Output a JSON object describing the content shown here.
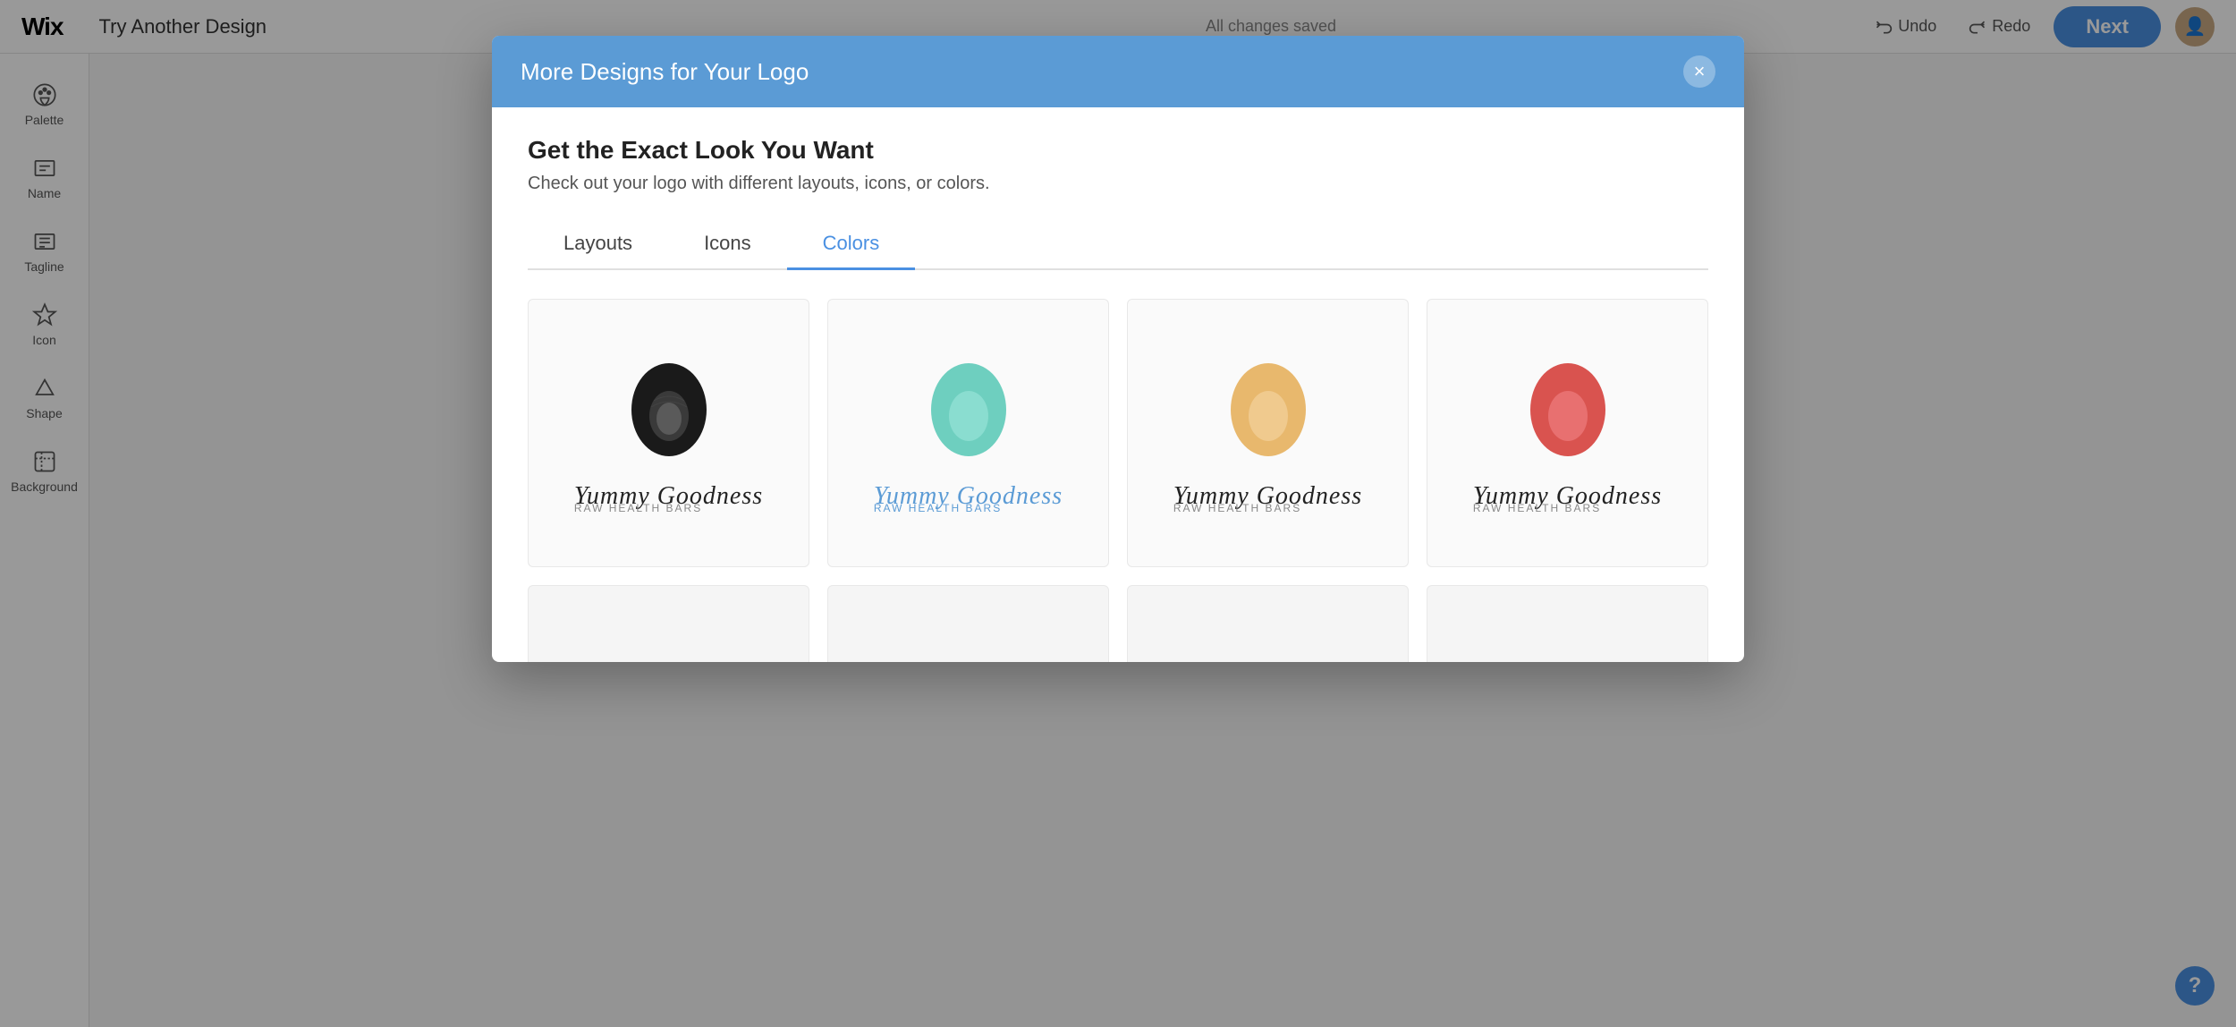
{
  "app": {
    "logo": "Wix",
    "title": "Try Another Design",
    "status": "All changes saved",
    "undo_label": "Undo",
    "redo_label": "Redo",
    "next_label": "Next"
  },
  "sidebar": {
    "items": [
      {
        "id": "palette",
        "label": "Palette",
        "icon": "palette-icon"
      },
      {
        "id": "name",
        "label": "Name",
        "icon": "name-icon"
      },
      {
        "id": "tagline",
        "label": "Tagline",
        "icon": "tagline-icon"
      },
      {
        "id": "icon",
        "label": "Icon",
        "icon": "icon-icon"
      },
      {
        "id": "shape",
        "label": "Shape",
        "icon": "shape-icon"
      },
      {
        "id": "background",
        "label": "Background",
        "icon": "background-icon"
      }
    ]
  },
  "modal": {
    "header_title": "More Designs for Your Logo",
    "heading": "Get the Exact Look You Want",
    "subheading": "Check out your logo with different layouts, icons, or colors.",
    "tabs": [
      {
        "id": "layouts",
        "label": "Layouts",
        "active": false
      },
      {
        "id": "icons",
        "label": "Icons",
        "active": false
      },
      {
        "id": "colors",
        "label": "Colors",
        "active": true
      }
    ],
    "close_label": "×",
    "logos": [
      {
        "id": "logo-black",
        "blob_color": "#2a2a2a",
        "name_text": "Yummy Goodness",
        "name_style": "default",
        "tagline": "Raw Health Bars",
        "tagline_style": "default"
      },
      {
        "id": "logo-teal",
        "blob_color": "#6ecfbf",
        "name_text": "Yummy Goodness",
        "name_style": "blue",
        "tagline": "Raw Health Bars",
        "tagline_style": "blue"
      },
      {
        "id": "logo-amber",
        "blob_color": "#e8b86d",
        "name_text": "Yummy Goodness",
        "name_style": "default",
        "tagline": "Raw Health Bars",
        "tagline_style": "default"
      },
      {
        "id": "logo-red",
        "blob_color": "#d9534f",
        "name_text": "Yummy Goodness",
        "name_style": "default",
        "tagline": "Raw Health Bars",
        "tagline_style": "default"
      }
    ]
  },
  "help": {
    "label": "?"
  }
}
